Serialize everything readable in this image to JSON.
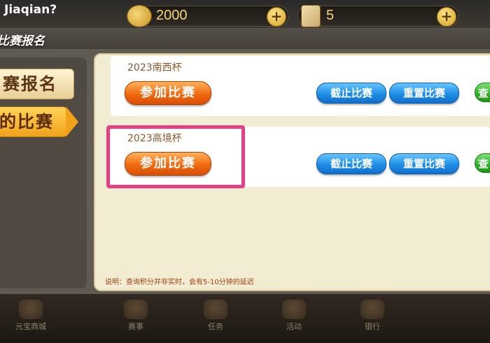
{
  "header": {
    "player_name": "Jiaqian?",
    "gold": "2000",
    "tickets": "5",
    "plus_symbol": "+"
  },
  "panel": {
    "title": "比赛报名"
  },
  "side_tabs": {
    "register": "赛报名",
    "my_matches": "的比赛"
  },
  "matches": [
    {
      "name": "2023南西杯",
      "join_label": "参加比赛",
      "stop_label": "截止比赛",
      "reset_label": "重置比赛",
      "extra_label": "查"
    },
    {
      "name": "2023高境杯",
      "join_label": "参加比赛",
      "stop_label": "截止比赛",
      "reset_label": "重置比赛",
      "extra_label": "查"
    }
  ],
  "note": "说明：查询积分并非实时，会有5-10分钟的延迟",
  "bottom_nav": {
    "shop": "元宝商城",
    "events": "赛事",
    "tasks": "任务",
    "activities": "活动",
    "bank": "银行"
  },
  "colors": {
    "highlight": "#e63f87",
    "join_button": "#f06a10",
    "blue_button": "#1f8ee6",
    "green_button": "#2fb42a"
  }
}
